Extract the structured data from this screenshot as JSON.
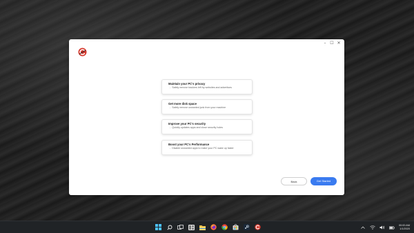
{
  "window": {
    "controls": {
      "minimize": "–",
      "maximize": "☐",
      "close": "✕"
    },
    "logo": "ccleaner-logo-icon"
  },
  "cards": [
    {
      "title": "Maintain your PC's privacy",
      "desc": "Safely remove trackers left by websites and advertises"
    },
    {
      "title": "Get more disk space",
      "desc": "Safely remove unwanted junk from your machine"
    },
    {
      "title": "Improve your PC's security",
      "desc": "Quickly updates apps and close security holes"
    },
    {
      "title": "Boost your PC's Performance",
      "desc": "Disable unwanted apps to make your PC wake up faster"
    }
  ],
  "buttons": {
    "back": "Back",
    "get_started": "Get Started"
  },
  "taskbar": {
    "icons": [
      "windows-start-icon",
      "search-icon",
      "task-view-icon",
      "widgets-icon",
      "file-explorer-icon",
      "firefox-icon",
      "chrome-icon",
      "store-icon",
      "steam-icon",
      "ccleaner-taskbar-icon"
    ],
    "clock": {
      "time": "00:00 AM",
      "date": "1/1/2020"
    }
  },
  "colors": {
    "accent": "#3a7bf0",
    "logo_red": "#d63a2f",
    "taskbar": "#202326"
  }
}
